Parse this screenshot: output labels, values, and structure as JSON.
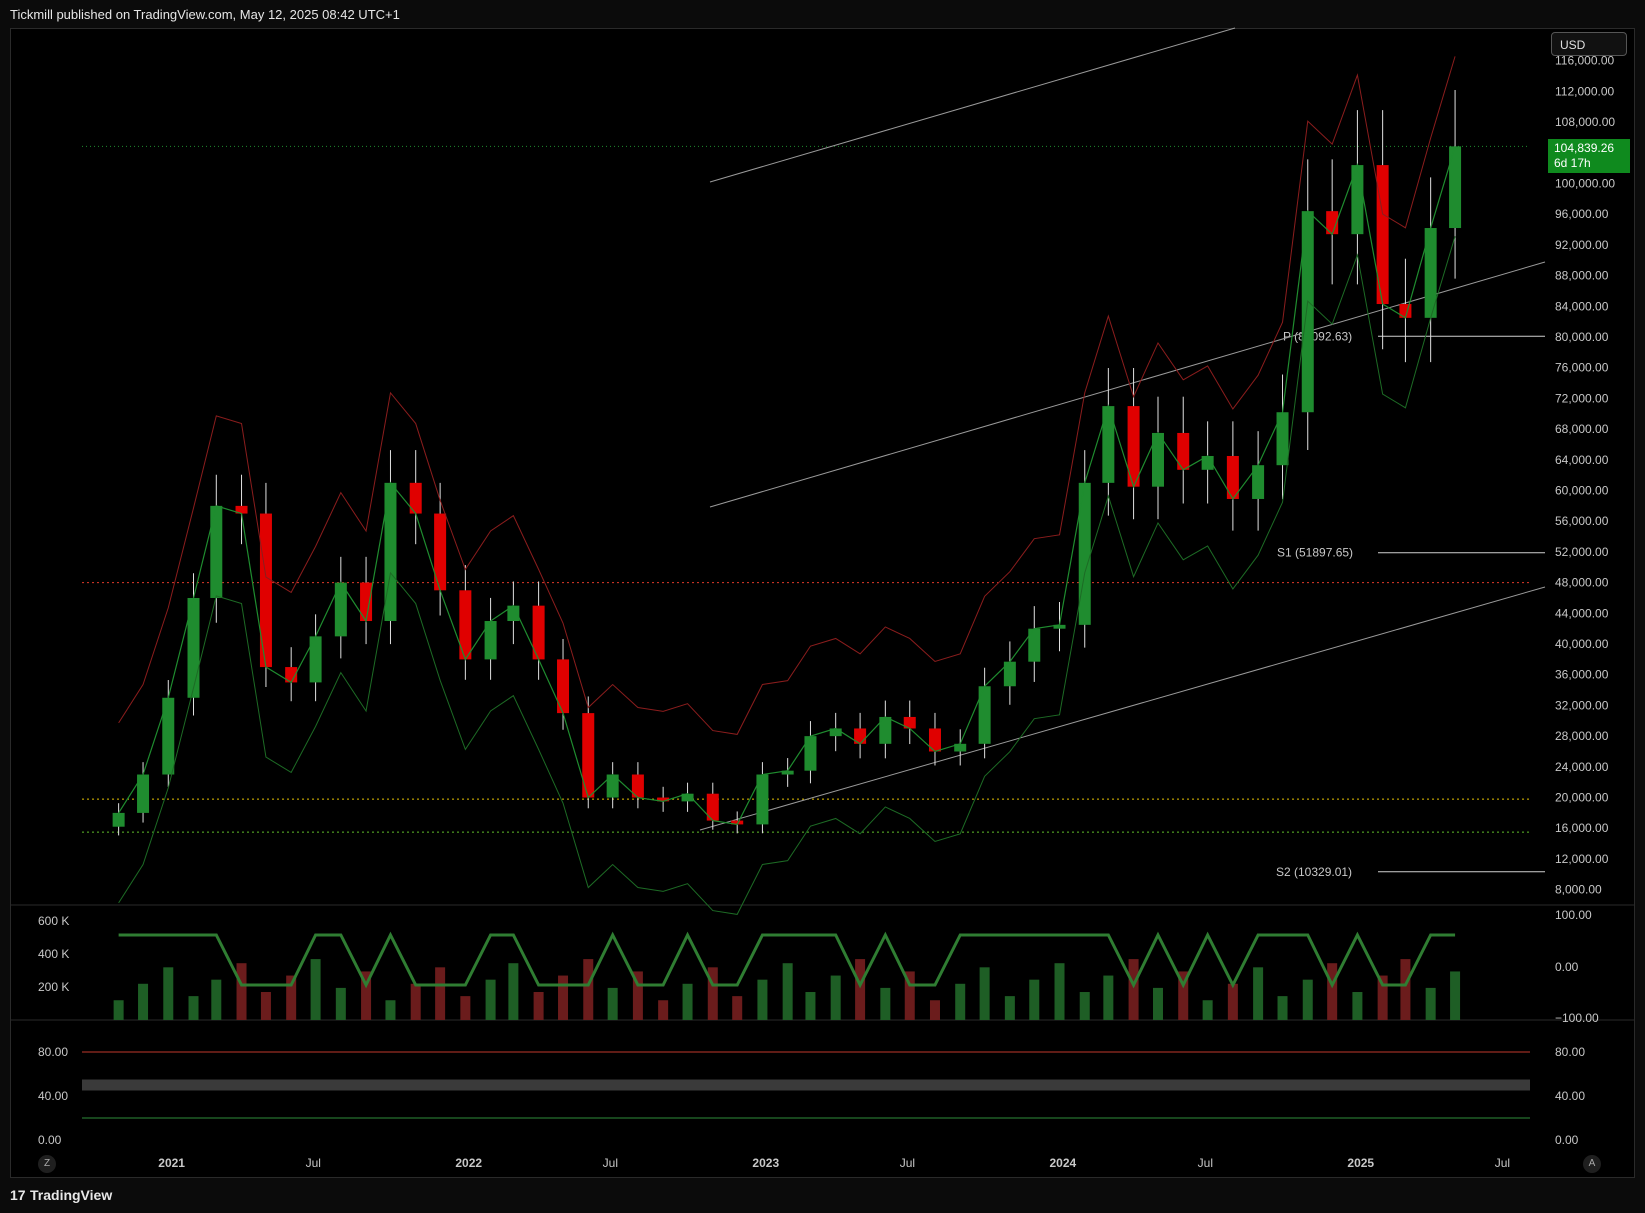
{
  "header": {
    "published": "Tickmill published on TradingView.com, May 12, 2025 08:42 UTC+1"
  },
  "currency_button": "USD",
  "last_price": {
    "value": "104,839.26",
    "countdown": "6d 17h"
  },
  "price_axis_labels": [
    "116,000.00",
    "112,000.00",
    "108,000.00",
    "100,000.00",
    "96,000.00",
    "92,000.00",
    "88,000.00",
    "84,000.00",
    "80,000.00",
    "76,000.00",
    "72,000.00",
    "68,000.00",
    "64,000.00",
    "60,000.00",
    "56,000.00",
    "52,000.00",
    "48,000.00",
    "44,000.00",
    "40,000.00",
    "36,000.00",
    "32,000.00",
    "28,000.00",
    "24,000.00",
    "20,000.00",
    "16,000.00",
    "12,000.00",
    "8,000.00"
  ],
  "pivot_labels": {
    "p": "P (80092.63)",
    "s1": "S1 (51897.65)",
    "s2": "S2 (10329.01)"
  },
  "volume_axis_labels": [
    "600 K",
    "400 K",
    "200 K"
  ],
  "osc_axis_labels": [
    "100.00",
    "0.00",
    "−100.00"
  ],
  "stoch_axis_labels": [
    "80.00",
    "40.00",
    "0.00"
  ],
  "time_axis_labels": [
    "2021",
    "Jul",
    "2022",
    "Jul",
    "2023",
    "Jul",
    "2024",
    "Jul",
    "2025",
    "Jul"
  ],
  "footer": {
    "brand": "TradingView",
    "z_button": "Z",
    "a_button": "A"
  },
  "colors": {
    "up": "#1f8c2f",
    "down": "#e00000",
    "background": "#000000",
    "accent": "#0f8a1e"
  },
  "chart_data": {
    "type": "candlestick",
    "symbol_currency": "USD",
    "interval": "weekly",
    "ylim": [
      6000,
      120000
    ],
    "x_range": [
      "2020-10",
      "2025-07"
    ],
    "close_series": [
      {
        "t": "2020-11",
        "c": 18000
      },
      {
        "t": "2020-12",
        "c": 23000
      },
      {
        "t": "2021-01",
        "c": 33000
      },
      {
        "t": "2021-02",
        "c": 46000
      },
      {
        "t": "2021-03",
        "c": 58000
      },
      {
        "t": "2021-04",
        "c": 57000
      },
      {
        "t": "2021-05",
        "c": 37000
      },
      {
        "t": "2021-06",
        "c": 35000
      },
      {
        "t": "2021-07",
        "c": 41000
      },
      {
        "t": "2021-08",
        "c": 48000
      },
      {
        "t": "2021-09",
        "c": 43000
      },
      {
        "t": "2021-10",
        "c": 61000
      },
      {
        "t": "2021-11",
        "c": 57000
      },
      {
        "t": "2021-12",
        "c": 47000
      },
      {
        "t": "2022-01",
        "c": 38000
      },
      {
        "t": "2022-02",
        "c": 43000
      },
      {
        "t": "2022-03",
        "c": 45000
      },
      {
        "t": "2022-04",
        "c": 38000
      },
      {
        "t": "2022-05",
        "c": 31000
      },
      {
        "t": "2022-06",
        "c": 20000
      },
      {
        "t": "2022-07",
        "c": 23000
      },
      {
        "t": "2022-08",
        "c": 20000
      },
      {
        "t": "2022-09",
        "c": 19500
      },
      {
        "t": "2022-10",
        "c": 20500
      },
      {
        "t": "2022-11",
        "c": 17000
      },
      {
        "t": "2022-12",
        "c": 16500
      },
      {
        "t": "2023-01",
        "c": 23000
      },
      {
        "t": "2023-02",
        "c": 23500
      },
      {
        "t": "2023-03",
        "c": 28000
      },
      {
        "t": "2023-04",
        "c": 29000
      },
      {
        "t": "2023-05",
        "c": 27000
      },
      {
        "t": "2023-06",
        "c": 30500
      },
      {
        "t": "2023-07",
        "c": 29000
      },
      {
        "t": "2023-08",
        "c": 26000
      },
      {
        "t": "2023-09",
        "c": 27000
      },
      {
        "t": "2023-10",
        "c": 34500
      },
      {
        "t": "2023-11",
        "c": 37700
      },
      {
        "t": "2023-12",
        "c": 42000
      },
      {
        "t": "2024-01",
        "c": 42500
      },
      {
        "t": "2024-02",
        "c": 61000
      },
      {
        "t": "2024-03",
        "c": 71000
      },
      {
        "t": "2024-04",
        "c": 60500
      },
      {
        "t": "2024-05",
        "c": 67500
      },
      {
        "t": "2024-06",
        "c": 62700
      },
      {
        "t": "2024-07",
        "c": 64500
      },
      {
        "t": "2024-08",
        "c": 58900
      },
      {
        "t": "2024-09",
        "c": 63300
      },
      {
        "t": "2024-10",
        "c": 70200
      },
      {
        "t": "2024-11",
        "c": 96400
      },
      {
        "t": "2024-12",
        "c": 93400
      },
      {
        "t": "2025-01",
        "c": 102400
      },
      {
        "t": "2025-02",
        "c": 84300
      },
      {
        "t": "2025-03",
        "c": 82500
      },
      {
        "t": "2025-04",
        "c": 94200
      },
      {
        "t": "2025-05",
        "c": 104839
      }
    ],
    "horizontal_levels": [
      {
        "name": "P",
        "value": 80092.63
      },
      {
        "name": "S1",
        "value": 51897.65
      },
      {
        "name": "S2",
        "value": 10329.01
      },
      {
        "name": "red-dotted",
        "value": 48000
      },
      {
        "name": "yellow-dotted",
        "value": 19800
      },
      {
        "name": "green-dotted",
        "value": 15500
      },
      {
        "name": "last-price",
        "value": 104839.26
      }
    ],
    "panes": [
      {
        "name": "volume",
        "ylim": [
          0,
          650000
        ]
      },
      {
        "name": "oscillator",
        "ylim": [
          -100,
          100
        ]
      },
      {
        "name": "stochastic",
        "ylim": [
          0,
          100
        ],
        "bands": [
          80,
          20
        ]
      }
    ]
  }
}
